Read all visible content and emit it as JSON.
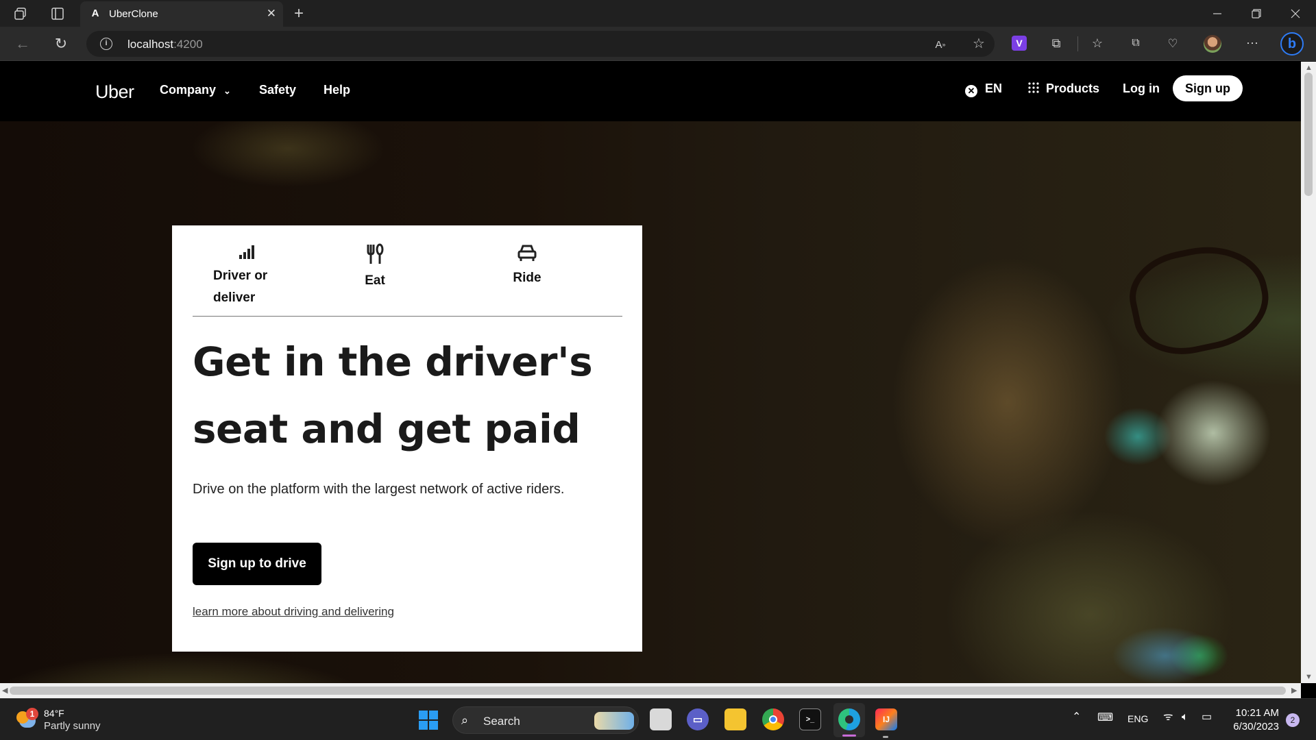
{
  "browser": {
    "tab_title": "UberClone",
    "tab_favicon": "A",
    "url_host": "localhost",
    "url_port": ":4200"
  },
  "nav": {
    "logo": "Uber",
    "items": [
      {
        "label": "Company"
      },
      {
        "label": "Safety"
      },
      {
        "label": "Help"
      }
    ],
    "language": "EN",
    "products": "Products",
    "login": "Log in",
    "signup": "Sign up"
  },
  "card": {
    "categories": [
      {
        "label": "Driver or deliver",
        "icon": "signal-bars-icon"
      },
      {
        "label": "Eat",
        "icon": "fork-knife-icon"
      },
      {
        "label": "Ride",
        "icon": "car-icon"
      }
    ],
    "headline": "Get in the driver's seat and get paid",
    "subtext": "Drive on the platform with the largest network of active riders.",
    "cta": "Sign up to drive",
    "link": "learn more about driving and delivering"
  },
  "taskbar": {
    "weather_temp": "84°F",
    "weather_desc": "Partly sunny",
    "weather_badge": "1",
    "search_label": "Search",
    "language": "ENG",
    "time": "10:21 AM",
    "date": "6/30/2023",
    "notification_count": "2"
  }
}
